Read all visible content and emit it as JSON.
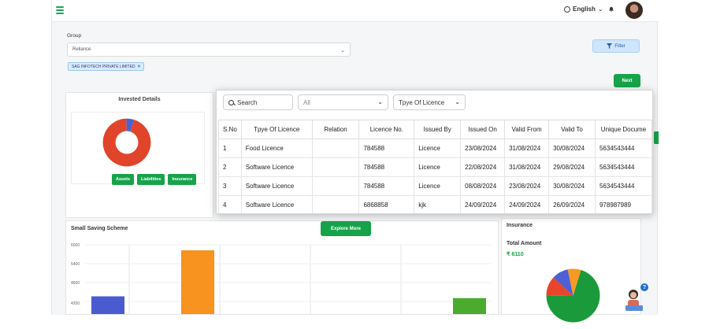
{
  "header": {
    "language": "English"
  },
  "filters": {
    "group_label": "Group",
    "group_value": "Reliance",
    "chip_label": "SAG INFOTECH PRIVATE LIMITED",
    "filter_label": "Filter",
    "next_label": "Next"
  },
  "invested": {
    "title": "Invested Details",
    "buttons": [
      "Assets",
      "Liabilities",
      "Insurance"
    ]
  },
  "small_saving": {
    "title": "Small Saving Scheme",
    "explore_label": "Explore More"
  },
  "insurance": {
    "title": "Insurance",
    "total_label": "Total Amount",
    "total_value": "₹ 6110"
  },
  "popup": {
    "search_placeholder": "Search",
    "select_all": "All",
    "select_type": "Tpye Of Licence",
    "columns": [
      "S.No",
      "Tpye Of Licence",
      "Relation",
      "Licence No.",
      "Issued By",
      "Issued On",
      "Valid From",
      "Valid To",
      "Unique Docume"
    ],
    "rows": [
      [
        "1",
        "Food Licence",
        "",
        "784588",
        "Licence",
        "23/08/2024",
        "31/08/2024",
        "30/08/2024",
        "5634543444"
      ],
      [
        "2",
        "Software Licence",
        "",
        "784588",
        "Licence",
        "22/08/2024",
        "31/08/2024",
        "29/08/2024",
        "5634543444"
      ],
      [
        "3",
        "Software Licence",
        "",
        "784588",
        "Licence",
        "08/08/2024",
        "23/08/2024",
        "30/08/2024",
        "5634543444"
      ],
      [
        "4",
        "Software Licence",
        "",
        "6868858",
        "kjk",
        "24/09/2024",
        "24/09/2024",
        "26/09/2024",
        "978987989"
      ]
    ]
  },
  "chart_data": [
    {
      "type": "bar",
      "ytick_labels": [
        "6000",
        "5400",
        "4600",
        "4200"
      ],
      "values": [
        4700,
        6000,
        4650
      ],
      "colors": [
        "#4a5bd0",
        "#f7931e",
        "#4aab2f"
      ],
      "ylim": [
        4200,
        6000
      ]
    },
    {
      "type": "pie",
      "values": [
        70,
        12,
        10,
        8
      ],
      "colors": [
        "#1a9a3a",
        "#e8452c",
        "#4f5fd4",
        "#f59a23"
      ]
    },
    {
      "type": "pie",
      "values": [
        95,
        5
      ],
      "colors": [
        "#e0452b",
        "#4a62cf"
      ]
    }
  ]
}
